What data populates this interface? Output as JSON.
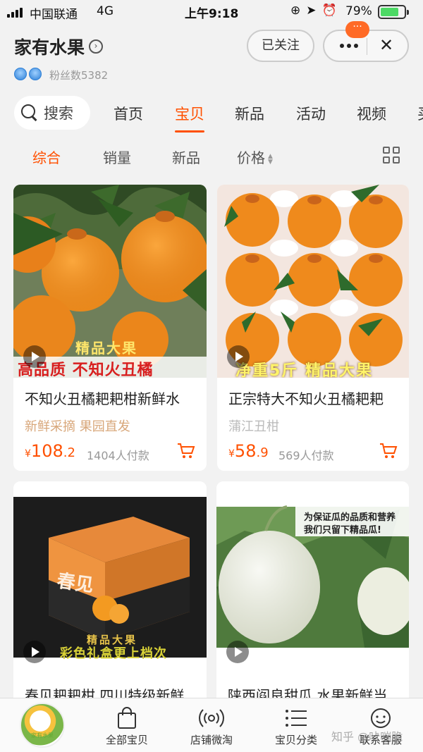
{
  "status": {
    "carrier": "中国联通",
    "network": "4G",
    "time": "上午9:18",
    "battery_pct": "79%",
    "battery_level": 0.79
  },
  "shop": {
    "name": "家有水果",
    "fans_label": "粉丝数5382",
    "follow_label": "已关注",
    "badge_dots": "···",
    "close_glyph": "✕"
  },
  "nav": {
    "search_label": "搜索",
    "tabs": [
      "首页",
      "宝贝",
      "新品",
      "活动",
      "视频",
      "买"
    ],
    "active_tab": 1
  },
  "sort": {
    "items": [
      "综合",
      "销量",
      "新品",
      "价格"
    ],
    "active": 0
  },
  "products": [
    {
      "title": "不知火丑橘耙耙柑新鲜水",
      "subtitle": "新鲜采摘 果园直发",
      "currency": "¥",
      "price_int": "108",
      "price_dec": ".2",
      "sold": "1404人付款",
      "img_caption_top": "精品大果",
      "img_caption_bottom": "高品质 不知火丑橘"
    },
    {
      "title": "正宗特大不知火丑橘耙耙",
      "subtitle": "蒲江丑柑",
      "currency": "¥",
      "price_int": "58",
      "price_dec": ".9",
      "sold": "569人付款",
      "img_caption_bottom": "净重5斤 精品大果"
    },
    {
      "title": "春见耙耙柑 四川特级新鲜",
      "img_caption_top": "精品大果",
      "img_caption_bottom": "彩色礼盒更上档次",
      "box_text": "春见"
    },
    {
      "title": "陕西阎良甜瓜 水果新鲜当",
      "img_caption_line1": "为保证瓜的品质和营养",
      "img_caption_line2": "我们只留下精品瓜!"
    }
  ],
  "tabbar": {
    "logo_text": "家有水果",
    "items": [
      "全部宝贝",
      "店铺微淘",
      "宝贝分类",
      "联系客服"
    ]
  },
  "watermark": "知乎 @咔嘣脆"
}
